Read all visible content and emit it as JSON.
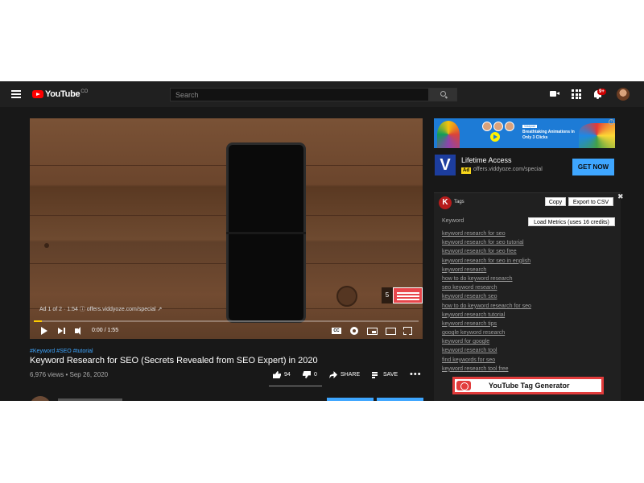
{
  "header": {
    "logo_text": "YouTube",
    "logo_suffix": "CO",
    "search_placeholder": "Search",
    "notification_count": "9+"
  },
  "player": {
    "ad_info": "Ad 1 of 2 · 1:54 ⓘ offers.viddyoze.com/special ↗",
    "ad_countdown": "5",
    "time": "0:00 / 1:55",
    "progress_fraction": 0.02,
    "cc_label": "CC"
  },
  "video": {
    "hashtags": "#Keyword #SEO #tutorial",
    "title": "Keyword Research for SEO (Secrets Revealed from SEO Expert) in 2020",
    "meta": "6,976 views • Sep 26, 2020",
    "likes": "94",
    "dislikes": "0",
    "share_label": "SHARE",
    "save_label": "SAVE",
    "more_label": "•••"
  },
  "ad": {
    "banner_tag": "Viddyoze",
    "banner_line1": "Breathtaking Animations In",
    "banner_line2": "Only 3 Clicks",
    "logo_letter": "V",
    "title": "Lifetime Access",
    "badge": "Ad",
    "url": "offers.viddyoze.com/special",
    "cta": "GET NOW",
    "info_icon": "i"
  },
  "tags_panel": {
    "logo_letter": "K",
    "label": "Tags",
    "copy_label": "Copy",
    "export_label": "Export to CSV",
    "close_label": "✖",
    "keyword_header": "Keyword",
    "load_metrics_label": "Load Metrics (uses 16 credits)",
    "keywords": [
      "keyword research for seo",
      "keyword research for seo tutorial",
      "keyword research for seo free",
      "keyword research for seo in english",
      "keyword research",
      "how to do keyword research",
      "seo keyword research",
      "keyword research seo",
      "how to do keyword research for seo",
      "keyword research tutorial",
      "keyword research tips",
      "google keyword research",
      "keyword for google",
      "keyword research tool",
      "find keywords for seo",
      "keyword research tool free"
    ],
    "generator_label": "YouTube Tag Generator"
  },
  "colors": {
    "accent_blue": "#3ea6ff",
    "youtube_red": "#ff0000",
    "progress_yellow": "#ffcc00"
  }
}
